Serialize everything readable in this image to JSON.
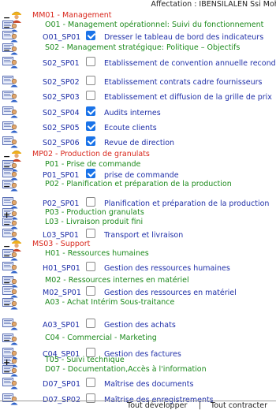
{
  "header": {
    "assignment": "Affectation : IBENSILALEN Ssi Mohammed"
  },
  "icons": {
    "user": "user-icon",
    "worker": "worker-icon"
  },
  "tree": [
    {
      "code": "MM01 - Management",
      "kind": "macro",
      "color": "#d8261b",
      "toggle": "−",
      "icon": "worker"
    },
    {
      "code": "O01 - Management opérationnel: Suivi du fonctionnement",
      "kind": "process",
      "color": "#1c8a1c",
      "toggle": "−",
      "icon": "user"
    },
    {
      "code": "O01_SP01",
      "label": "Dresser le tableau de bord des indicateurs",
      "kind": "sub",
      "checked": true,
      "icon": "user"
    },
    {
      "code": "S02 - Management stratégique: Politique – Objectifs",
      "kind": "process",
      "color": "#1c8a1c",
      "toggle": "−",
      "icon": "user"
    },
    {
      "code": "S02_SP01",
      "label": "Etablissement de convention annuelle reconduction",
      "kind": "sub",
      "checked": false,
      "icon": "user"
    },
    {
      "code": "S02_SP02",
      "label": "Etablissement contrats cadre fournisseurs",
      "kind": "sub",
      "checked": false,
      "icon": "user"
    },
    {
      "code": "S02_SP03",
      "label": "Etablissement et diffusion de la grille de prix",
      "kind": "sub",
      "checked": false,
      "icon": "user"
    },
    {
      "code": "S02_SP04",
      "label": "Audits internes",
      "kind": "sub",
      "checked": true,
      "icon": "user"
    },
    {
      "code": "S02_SP05",
      "label": "Ecoute clients",
      "kind": "sub",
      "checked": true,
      "icon": "user"
    },
    {
      "code": "S02_SP06",
      "label": "Revue de direction",
      "kind": "sub",
      "checked": true,
      "icon": "user"
    },
    {
      "code": "MP02 - Production de granulats",
      "kind": "macro",
      "color": "#d8261b",
      "toggle": "−",
      "icon": "worker"
    },
    {
      "code": "P01 - Prise de commande",
      "kind": "process",
      "color": "#1c8a1c",
      "toggle": "−",
      "icon": "user"
    },
    {
      "code": "P01_SP01",
      "label": "prise de commande",
      "kind": "sub",
      "checked": true,
      "icon": "user"
    },
    {
      "code": "P02 - Planification et préparation de la production",
      "kind": "process",
      "color": "#1c8a1c",
      "toggle": "−",
      "icon": "user"
    },
    {
      "code": "P02_SP01",
      "label": "Planification et préparation de la production",
      "kind": "sub",
      "checked": false,
      "icon": "user"
    },
    {
      "code": "P03 - Production granulats",
      "kind": "process",
      "color": "#1c8a1c",
      "toggle": "+",
      "icon": "user"
    },
    {
      "code": "L03 - Livraison produit fini",
      "kind": "process",
      "color": "#1c8a1c",
      "toggle": "−",
      "icon": "user"
    },
    {
      "code": "L03_SP01",
      "label": "Transport et livraison",
      "kind": "sub",
      "checked": false,
      "icon": "user"
    },
    {
      "code": "MS03 - Support",
      "kind": "macro",
      "color": "#d8261b",
      "toggle": "−",
      "icon": "worker"
    },
    {
      "code": "H01 - Ressources humaines",
      "kind": "process",
      "color": "#1c8a1c",
      "toggle": "−",
      "icon": "user"
    },
    {
      "code": "H01_SP01",
      "label": "Gestion des ressources humaines",
      "kind": "sub",
      "checked": false,
      "icon": "user"
    },
    {
      "code": "M02 - Ressources internes en matériel",
      "kind": "process",
      "color": "#1c8a1c",
      "toggle": "−",
      "icon": "user"
    },
    {
      "code": "M02_SP01",
      "label": "Gestion des ressources en matériel",
      "kind": "sub",
      "checked": false,
      "icon": "user"
    },
    {
      "code": "A03 - Achat Intérim Sous-traitance",
      "kind": "process",
      "color": "#1c8a1c",
      "toggle": "−",
      "icon": "user"
    },
    {
      "code": "A03_SP01",
      "label": "Gestion des achats",
      "kind": "sub",
      "checked": false,
      "icon": "user"
    },
    {
      "code": "C04 - Commercial - Marketing",
      "kind": "process",
      "color": "#1c8a1c",
      "toggle": "−",
      "icon": "user"
    },
    {
      "code": "C04_SP01",
      "label": "Gestion des factures",
      "kind": "sub",
      "checked": false,
      "icon": "user"
    },
    {
      "code": "T05 - Suivi technique",
      "kind": "process",
      "color": "#1c8a1c",
      "toggle": "+",
      "icon": "user"
    },
    {
      "code": "D07 - Documentation,Accès à l'information",
      "kind": "process",
      "color": "#1c8a1c",
      "toggle": "−",
      "icon": "user"
    },
    {
      "code": "D07_SP01",
      "label": "Maîtrise des documents",
      "kind": "sub",
      "checked": false,
      "icon": "user"
    },
    {
      "code": "D07_SP02",
      "label": "Maîtrise des enregistrements",
      "kind": "sub",
      "checked": false,
      "icon": "user"
    }
  ],
  "footer": {
    "expand_all": "Tout développer",
    "separator": "|",
    "collapse_all": "Tout contracter"
  }
}
